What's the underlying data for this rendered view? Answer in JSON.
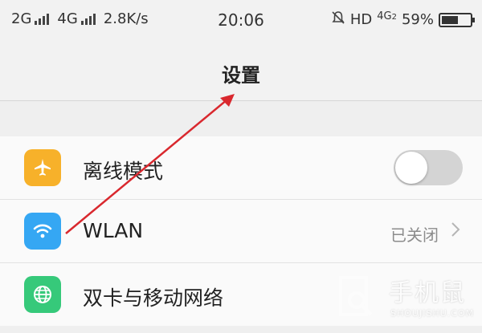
{
  "status_bar": {
    "left_text": "2G",
    "network_2": "4G",
    "speed": "2.8K/s",
    "time": "20:06",
    "hd_label": "HD",
    "lte_label": "4G",
    "lte_sub": "2",
    "battery_percent": "59%",
    "battery_level": 0.59,
    "icons": [
      "signal-bars-icon",
      "signal-bars-icon",
      "mute-bell-icon",
      "battery-icon"
    ]
  },
  "nav": {
    "title": "设置"
  },
  "settings": {
    "items": [
      {
        "label": "离线模式",
        "icon": "airplane-icon",
        "icon_color": "#f7b12a",
        "control": "toggle",
        "toggle_on": false
      },
      {
        "label": "WLAN",
        "icon": "wifi-icon",
        "icon_color": "#35a7f3",
        "value": "已关闭",
        "control": "chevron"
      },
      {
        "label": "双卡与移动网络",
        "icon": "globe-icon",
        "icon_color": "#36c97a",
        "control": "none"
      }
    ]
  },
  "watermark": {
    "text_cn": "手机鼠",
    "text_en": "SHOUJISHU.COM"
  },
  "annotation": {
    "arrow_color": "#d9282e"
  }
}
